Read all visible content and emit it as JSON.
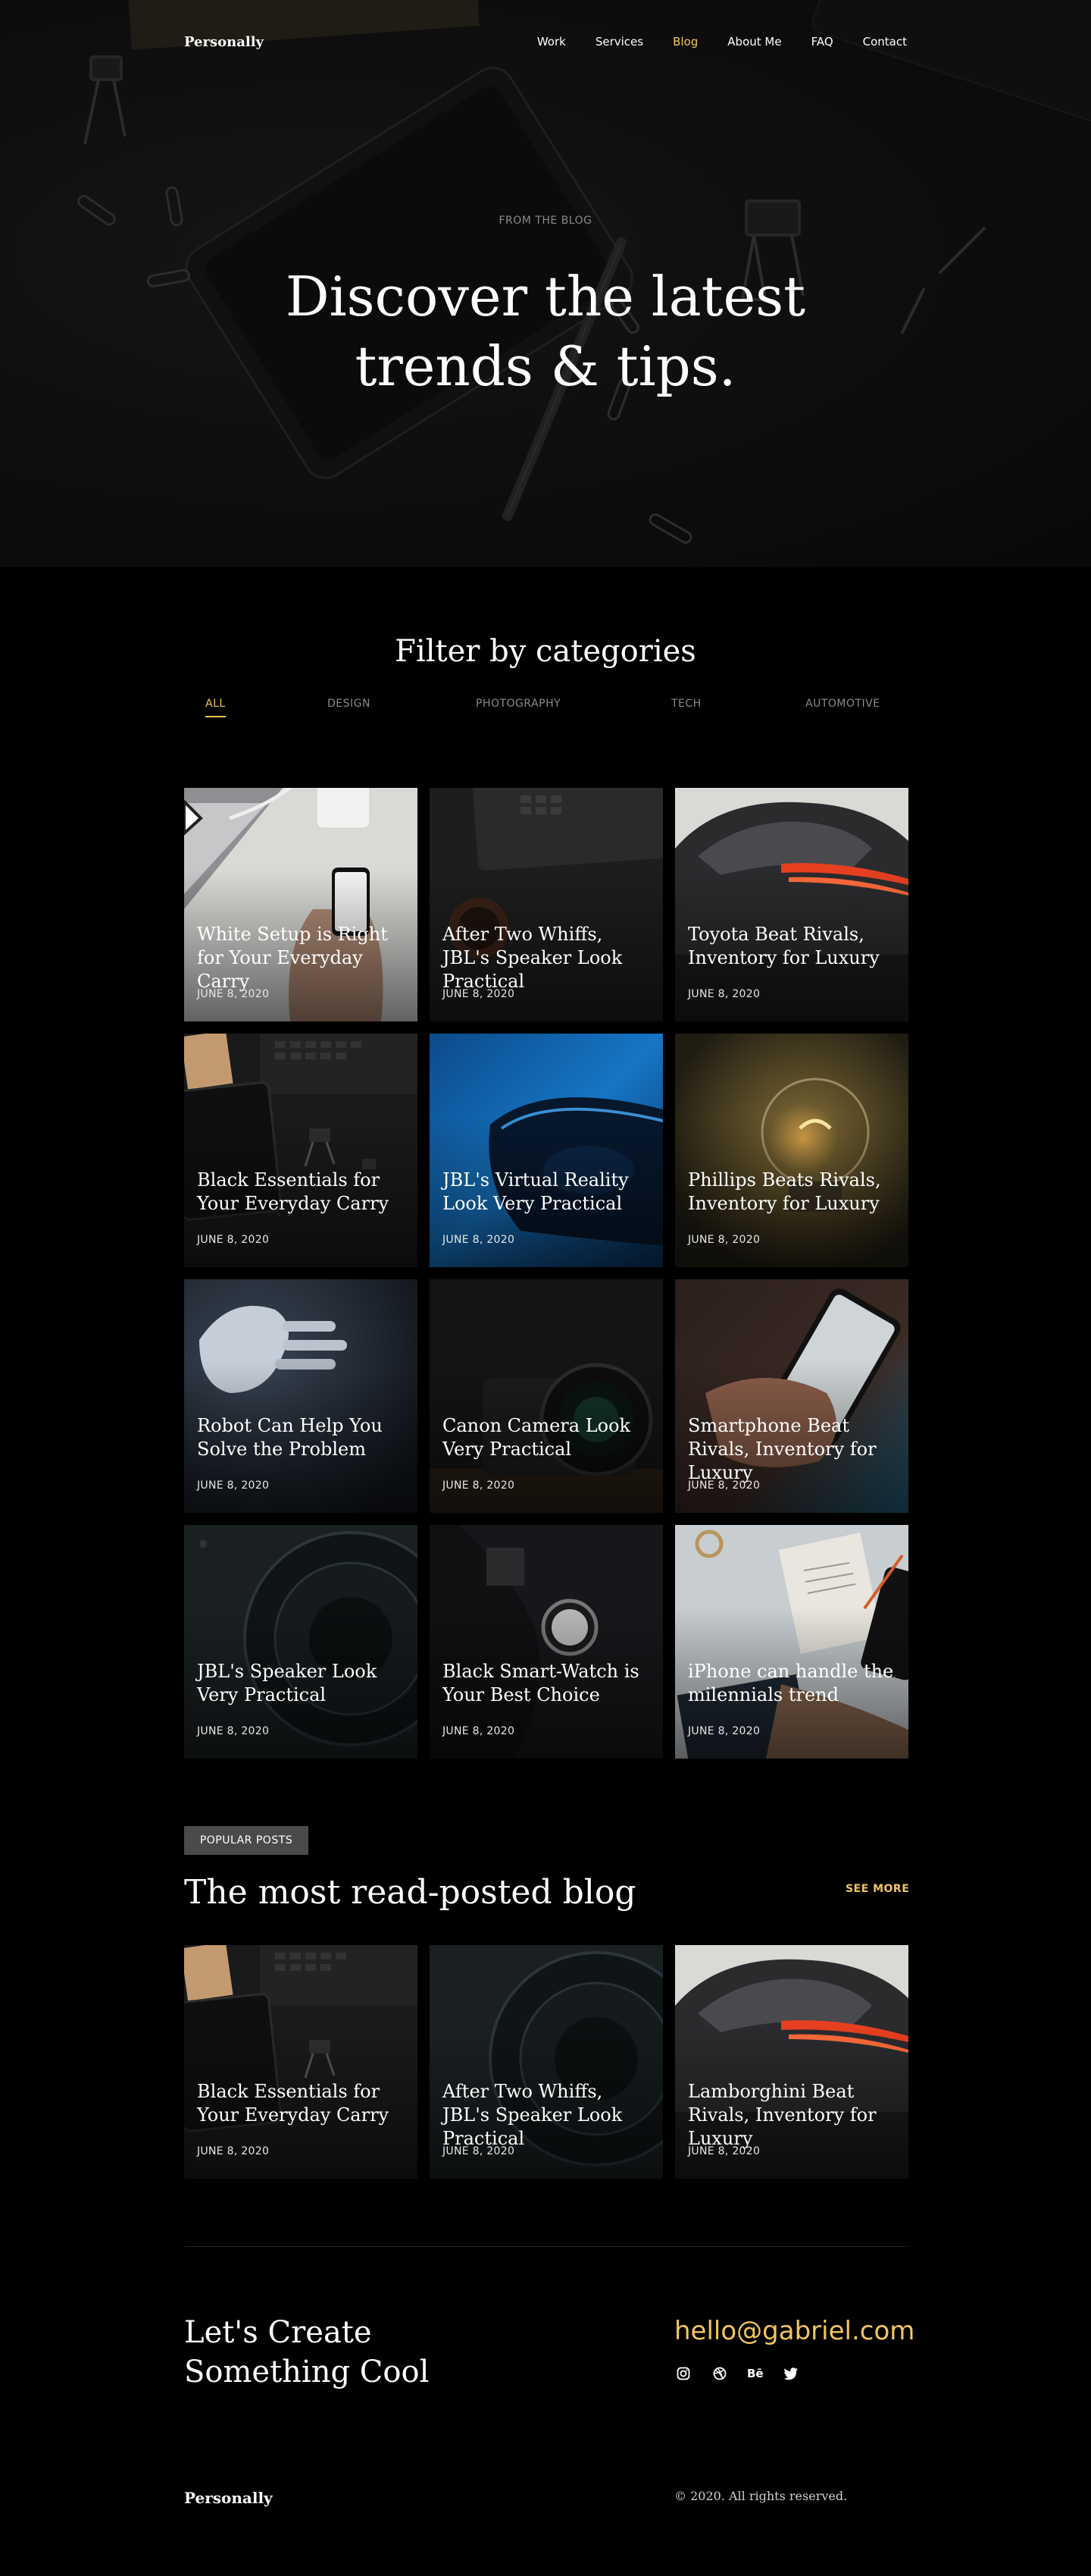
{
  "nav": {
    "brand": "Personally",
    "links": [
      "Work",
      "Services",
      "Blog",
      "About Me",
      "FAQ",
      "Contact"
    ],
    "active": "Blog"
  },
  "hero": {
    "kicker": "FROM THE BLOG",
    "title_line1": "Discover the latest",
    "title_line2": "trends & tips."
  },
  "filter": {
    "title": "Filter by categories",
    "tabs": [
      "ALL",
      "DESIGN",
      "PHOTOGRAPHY",
      "TECH",
      "AUTOMOTIVE"
    ],
    "active": "ALL"
  },
  "posts": [
    {
      "title": "White Setup is Right for Your Everyday Carry",
      "date": "JUNE 8, 2020"
    },
    {
      "title": "After Two Whiffs, JBL's Speaker Look Practical",
      "date": "JUNE 8, 2020"
    },
    {
      "title": "Toyota Beat Rivals, Inventory for Luxury",
      "date": "JUNE 8, 2020"
    },
    {
      "title": "Black Essentials for Your Everyday Carry",
      "date": "JUNE 8, 2020"
    },
    {
      "title": "JBL's Virtual Reality Look Very Practical",
      "date": "JUNE 8, 2020"
    },
    {
      "title": "Phillips Beats Rivals, Inventory for Luxury",
      "date": "JUNE 8, 2020"
    },
    {
      "title": "Robot Can Help You Solve the Problem",
      "date": "JUNE 8, 2020"
    },
    {
      "title": "Canon Camera Look Very Practical",
      "date": "JUNE 8, 2020"
    },
    {
      "title": "Smartphone Beat Rivals, Inventory for Luxury",
      "date": "JUNE 8, 2020"
    },
    {
      "title": "JBL's Speaker Look Very Practical",
      "date": "JUNE 8, 2020"
    },
    {
      "title": "Black Smart-Watch is Your Best Choice",
      "date": "JUNE 8, 2020"
    },
    {
      "title": "iPhone can handle the milennials trend",
      "date": "JUNE 8, 2020"
    }
  ],
  "popular": {
    "badge": "POPULAR POSTS",
    "title": "The most read-posted blog",
    "see_more": "SEE MORE",
    "posts": [
      {
        "title": "Black Essentials for Your Everyday Carry",
        "date": "JUNE 8, 2020"
      },
      {
        "title": "After Two Whiffs, JBL's Speaker Look Practical",
        "date": "JUNE 8, 2020"
      },
      {
        "title": "Lamborghini Beat Rivals, Inventory for Luxury",
        "date": "JUNE 8, 2020"
      }
    ]
  },
  "cta": {
    "line1": "Let's Create",
    "line2": "Something Cool",
    "email": "hello@gabriel.com",
    "socials": [
      "instagram-icon",
      "dribbble-icon",
      "behance-icon",
      "twitter-icon"
    ],
    "behance_glyph": "Bē"
  },
  "footer": {
    "brand": "Personally",
    "copyright": "© 2020. All rights reserved."
  },
  "colors": {
    "accent": "#f2c55c",
    "background": "#000000",
    "muted": "#8a8a8a",
    "badge": "#4a4a4a"
  }
}
